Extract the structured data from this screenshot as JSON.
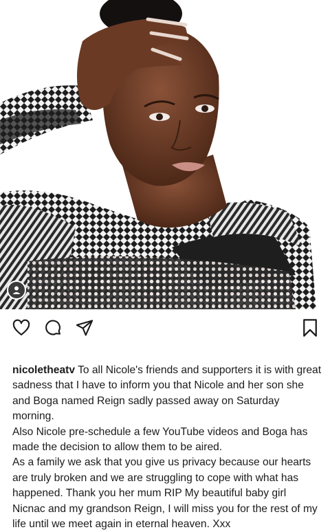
{
  "post": {
    "photo_label": "portrait photo",
    "tag_icon": "person-tag-icon",
    "actions": {
      "like_icon": "heart-icon",
      "comment_icon": "comment-icon",
      "share_icon": "send-icon",
      "save_icon": "bookmark-icon"
    },
    "caption": {
      "username": "nicoletheatv",
      "paragraph_1": "To all Nicole's friends and supporters it is with great sadness that I have to inform you that Nicole and her son she and Boga named Reign sadly passed away on Saturday morning.",
      "paragraph_2": "Also Nicole pre-schedule a few YouTube videos and Boga has made the decision to allow them to be aired.",
      "paragraph_3": "As a family we ask that you give us privacy because our hearts are truly broken and we are struggling to cope with what has happened. Thank you her mum RIP My beautiful baby girl Nicnac and my grandson Reign, I will miss you for the rest of my life until we meet again in eternal heaven. Xxx"
    }
  }
}
